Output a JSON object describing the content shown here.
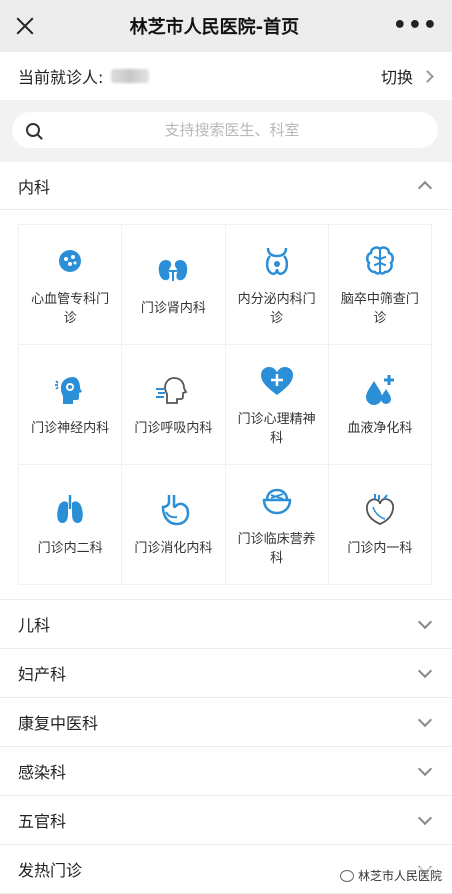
{
  "header": {
    "title": "林芝市人民医院-首页",
    "more": "•••"
  },
  "patient": {
    "label": "当前就诊人:",
    "switch_label": "切换"
  },
  "search": {
    "placeholder": "支持搜索医生、科室"
  },
  "accent_color": "#2a8fd6",
  "sections": [
    {
      "title": "内科",
      "expanded": true,
      "items": [
        {
          "label": "心血管专科门诊",
          "icon": "heart-dots-icon"
        },
        {
          "label": "门诊肾内科",
          "icon": "kidney-icon"
        },
        {
          "label": "内分泌内科门诊",
          "icon": "thyroid-icon"
        },
        {
          "label": "脑卒中筛查门诊",
          "icon": "brain-icon"
        },
        {
          "label": "门诊神经内科",
          "icon": "head-neuro-icon"
        },
        {
          "label": "门诊呼吸内科",
          "icon": "head-breath-icon"
        },
        {
          "label": "门诊心理精神科",
          "icon": "heart-plus-icon"
        },
        {
          "label": "血液净化科",
          "icon": "blood-drop-icon"
        },
        {
          "label": "门诊内二科",
          "icon": "lungs-icon"
        },
        {
          "label": "门诊消化内科",
          "icon": "stomach-icon"
        },
        {
          "label": "门诊临床营养科",
          "icon": "bowl-icon"
        },
        {
          "label": "门诊内一科",
          "icon": "heart-organ-icon"
        }
      ]
    },
    {
      "title": "儿科",
      "expanded": false
    },
    {
      "title": "妇产科",
      "expanded": false
    },
    {
      "title": "康复中医科",
      "expanded": false
    },
    {
      "title": "感染科",
      "expanded": false
    },
    {
      "title": "五官科",
      "expanded": false
    },
    {
      "title": "发热门诊",
      "expanded": false
    }
  ],
  "watermark": "林芝市人民医院"
}
